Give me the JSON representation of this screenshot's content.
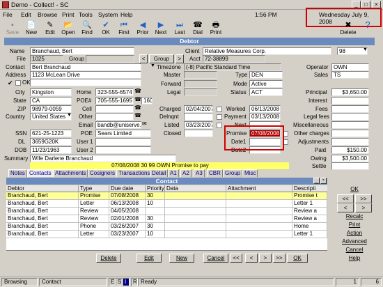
{
  "window": {
    "title": "Demo - Collect! - SC"
  },
  "menu": [
    "File",
    "Edit",
    "Browse",
    "Print",
    "Tools",
    "System",
    "Help"
  ],
  "clock": "1:56 PM",
  "date": "Wednesday July 9, 2008",
  "toolbar": [
    "Save",
    "New",
    "Edit",
    "Open",
    "Find",
    "OK",
    "First",
    "Prior",
    "Next",
    "Last",
    "Dial",
    "Print"
  ],
  "toolbar_right": [
    "Delete"
  ],
  "panel_title": "Debtor",
  "debtor": {
    "name_label": "Name",
    "name": "Branchaud, Bert",
    "file_label": "File",
    "file": "1025",
    "group_label": "Group",
    "group_btn": "Group",
    "contact_label": "Contact",
    "contact": "Bert Branchaud",
    "address_label": "Address",
    "address": "1123 McLean Drive",
    "ok_label": "OK",
    "city_label": "City",
    "city": "Kingston",
    "state_label": "State",
    "state": "CA",
    "zip_label": "ZIP",
    "zip": "98979-0059",
    "country_label": "Country",
    "country": "United States",
    "ssn_label": "SSN",
    "ssn": "621-25-1223",
    "dl_label": "DL",
    "dl": "3659G20K",
    "dob_label": "DOB",
    "dob": "11/23/1963",
    "summary_label": "Summary",
    "summary": "Wife Darlene Branchaud",
    "home_label": "Home",
    "home": "323-555-6574",
    "poe_label": "POE#",
    "poe_num": "705-555-1695",
    "poe_ext": "160",
    "cell_label": "Cell",
    "other_label": "Other",
    "email_label": "Email",
    "email": "bandb@uniserve.com",
    "poe2_label": "POE",
    "poe2": "Sears Limited",
    "user1_label": "User 1",
    "user2_label": "User 2",
    "client_label": "Client",
    "client": "Relative Measures Corp.",
    "client_num": "98",
    "acct_label": "Acct",
    "acct": "72-38899",
    "timezone_label": "Timezone",
    "timezone": "(-8) Pacific Standard Time",
    "master_label": "Master",
    "forward_label": "Forward",
    "legal_label": "Legal",
    "charged_label": "Charged",
    "charged": "02/04/2007",
    "delnqnt_label": "Delnqnt",
    "listed_label": "Listed",
    "listed": "03/23/2007",
    "closed_label": "Closed",
    "type_label": "Type",
    "type": "DEN",
    "mode_label": "Mode",
    "mode": "Active",
    "status_label": "Status",
    "status": "ACT",
    "worked_label": "Worked",
    "worked": "06/13/2008",
    "payment_label": "Payment",
    "payment": "03/13/2008",
    "next_label": "Next",
    "promise_label": "Promise",
    "promise": "07/08/2008",
    "date1_label": "Date1",
    "date2_label": "Date2",
    "operator_label": "Operator",
    "operator": "OWN",
    "sales_label": "Sales",
    "sales": "TS",
    "principal_label": "Principal",
    "principal": "$3,650.00",
    "interest_label": "Interest",
    "fees_label": "Fees",
    "legalfees_label": "Legal fees",
    "misc_label": "Miscellaneous",
    "othercharges_label": "Other charges",
    "adjustments_label": "Adjustments",
    "paid_label": "Paid",
    "paid": "$150.00",
    "owing_label": "Owing",
    "owing": "$3,500.00",
    "settle_label": "Settle",
    "note": "07/08/2008 30 99 OWN Promise to pay"
  },
  "tabs": [
    "Notes",
    "Contacts",
    "Attachments",
    "Cosigners",
    "Transactions",
    "Detail",
    "A1",
    "A2",
    "A3",
    "CBR",
    "Group",
    "Misc"
  ],
  "contact_panel": {
    "title": "Contact",
    "columns": [
      "Debtor",
      "Type",
      "Due date",
      "Priority",
      "Data",
      "Attachment",
      "Descripti"
    ],
    "rows": [
      [
        "Branchaud, Bert",
        "Promise",
        "07/08/2008",
        "30",
        "",
        "",
        "Promise t"
      ],
      [
        "Branchaud, Bert",
        "Letter",
        "06/13/2008",
        "10",
        "",
        "",
        "Letter 1"
      ],
      [
        "Branchaud, Bert",
        "Review",
        "04/05/2008",
        "",
        "",
        "",
        "Review a"
      ],
      [
        "Branchaud, Bert",
        "Review",
        "02/01/2008",
        "30",
        "",
        "",
        "Review a"
      ],
      [
        "Branchaud, Bert",
        "Phone",
        "03/26/2007",
        "30",
        "",
        "",
        "Home"
      ],
      [
        "Branchaud, Bert",
        "Letter",
        "03/23/2007",
        "10",
        "",
        "",
        "Letter 1"
      ]
    ],
    "buttons": [
      "Delete",
      "Edit",
      "New",
      "Cancel",
      "<<",
      "<",
      ">",
      ">>",
      "OK"
    ]
  },
  "side_buttons": [
    "OK",
    "<<",
    ">>",
    "<",
    ">",
    "Recalc",
    "Print",
    "Action",
    "Advanced",
    "Cancel",
    "Help"
  ],
  "statusbar": {
    "mode": "Browsing",
    "context": "Contact",
    "keys": [
      "E",
      "S",
      "I",
      "R"
    ],
    "state": "Ready",
    "page": "1",
    "total": "6"
  }
}
